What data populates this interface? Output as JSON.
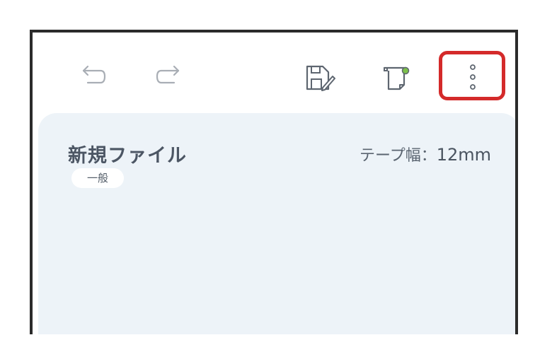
{
  "toolbar": {
    "icons": [
      "undo-icon",
      "redo-icon",
      "save-icon",
      "label-edit-icon",
      "more-vert-icon"
    ],
    "highlight_color": "#d42a2a"
  },
  "document": {
    "file_name": "新規ファイル",
    "category": "一般",
    "tape_width_label": "テープ幅：",
    "tape_width_value": "12mm"
  },
  "colors": {
    "panel_background": "#edf3f8",
    "frame_border": "#2b2b2b",
    "icon_gray": "#a9aeb5",
    "icon_dark": "#5e6670",
    "accent_green": "#7cc04a"
  }
}
